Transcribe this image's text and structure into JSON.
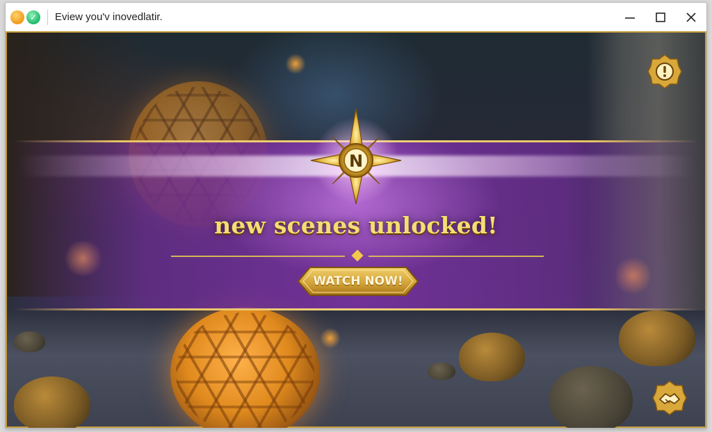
{
  "window": {
    "title": "Eview you'v inovedlatir.",
    "controls": {
      "minimize": "minimize-icon",
      "maximize": "maximize-icon",
      "close": "close-icon"
    }
  },
  "game": {
    "banner": {
      "emblem_letter": "N",
      "headline": "new scenes unlocked!",
      "cta_label": "WATCH NOW!"
    },
    "corner_buttons": {
      "top_right": "alert-icon",
      "bottom_right": "handshake-icon"
    }
  },
  "colors": {
    "accent_gold": "#e7c364",
    "banner_purple": "#7a32a0",
    "headline_text": "#f4de74",
    "button_gold": "#d4a53a"
  }
}
